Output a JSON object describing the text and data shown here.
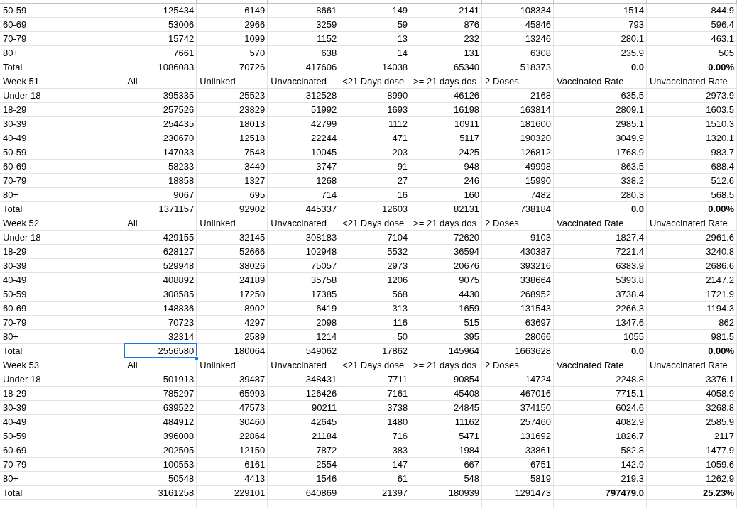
{
  "sheet": {
    "rows": [
      {
        "kind": "data",
        "selection": [
          false,
          false,
          false,
          false,
          false,
          false,
          false,
          false,
          false
        ],
        "cells": [
          "50-59",
          "125434",
          "6149",
          "8661",
          "149",
          "2141",
          "108334",
          "1514",
          "844.9"
        ]
      },
      {
        "kind": "data",
        "selection": [
          false,
          false,
          false,
          false,
          false,
          false,
          false,
          false,
          false
        ],
        "cells": [
          "60-69",
          "53006",
          "2966",
          "3259",
          "59",
          "876",
          "45846",
          "793",
          "596.4"
        ]
      },
      {
        "kind": "data",
        "selection": [
          false,
          false,
          false,
          false,
          false,
          false,
          false,
          false,
          false
        ],
        "cells": [
          "70-79",
          "15742",
          "1099",
          "1152",
          "13",
          "232",
          "13246",
          "280.1",
          "463.1"
        ]
      },
      {
        "kind": "data",
        "selection": [
          false,
          false,
          false,
          false,
          false,
          false,
          false,
          false,
          false
        ],
        "cells": [
          "80+",
          "7661",
          "570",
          "638",
          "14",
          "131",
          "6308",
          "235.9",
          "505"
        ]
      },
      {
        "kind": "total",
        "selection": [
          false,
          false,
          false,
          false,
          false,
          false,
          false,
          false,
          false
        ],
        "cells": [
          "Total",
          "1086083",
          "70726",
          "417606",
          "14038",
          "65340",
          "518373",
          "0.0",
          "0.00%"
        ]
      },
      {
        "kind": "header",
        "selection": [
          false,
          false,
          false,
          false,
          false,
          false,
          false,
          false,
          false
        ],
        "cells": [
          "Week 51",
          "All",
          "Unlinked",
          "Unvaccinated",
          "<21 Days dose",
          ">= 21 days dos",
          "2 Doses",
          "Vaccinated Rate",
          "Unvaccinated Rate"
        ]
      },
      {
        "kind": "data",
        "selection": [
          false,
          false,
          false,
          false,
          false,
          false,
          false,
          false,
          false
        ],
        "cells": [
          "Under 18",
          "395335",
          "25523",
          "312528",
          "8990",
          "46126",
          "2168",
          "635.5",
          "2973.9"
        ]
      },
      {
        "kind": "data",
        "selection": [
          false,
          false,
          false,
          false,
          false,
          false,
          false,
          false,
          false
        ],
        "cells": [
          "18-29",
          "257526",
          "23829",
          "51992",
          "1693",
          "16198",
          "163814",
          "2809.1",
          "1603.5"
        ]
      },
      {
        "kind": "data",
        "selection": [
          false,
          false,
          false,
          false,
          false,
          false,
          false,
          false,
          false
        ],
        "cells": [
          "30-39",
          "254435",
          "18013",
          "42799",
          "1112",
          "10911",
          "181600",
          "2985.1",
          "1510.3"
        ]
      },
      {
        "kind": "data",
        "selection": [
          false,
          false,
          false,
          false,
          false,
          false,
          false,
          false,
          false
        ],
        "cells": [
          "40-49",
          "230670",
          "12518",
          "22244",
          "471",
          "5117",
          "190320",
          "3049.9",
          "1320.1"
        ]
      },
      {
        "kind": "data",
        "selection": [
          false,
          false,
          false,
          false,
          false,
          false,
          false,
          false,
          false
        ],
        "cells": [
          "50-59",
          "147033",
          "7548",
          "10045",
          "203",
          "2425",
          "126812",
          "1768.9",
          "983.7"
        ]
      },
      {
        "kind": "data",
        "selection": [
          false,
          false,
          false,
          false,
          false,
          false,
          false,
          false,
          false
        ],
        "cells": [
          "60-69",
          "58233",
          "3449",
          "3747",
          "91",
          "948",
          "49998",
          "863.5",
          "688.4"
        ]
      },
      {
        "kind": "data",
        "selection": [
          false,
          false,
          false,
          false,
          false,
          false,
          false,
          false,
          false
        ],
        "cells": [
          "70-79",
          "18858",
          "1327",
          "1268",
          "27",
          "246",
          "15990",
          "338.2",
          "512.6"
        ]
      },
      {
        "kind": "data",
        "selection": [
          false,
          false,
          false,
          false,
          false,
          false,
          false,
          false,
          false
        ],
        "cells": [
          "80+",
          "9067",
          "695",
          "714",
          "16",
          "160",
          "7482",
          "280.3",
          "568.5"
        ]
      },
      {
        "kind": "total",
        "selection": [
          false,
          false,
          false,
          false,
          false,
          false,
          false,
          false,
          false
        ],
        "cells": [
          "Total",
          "1371157",
          "92902",
          "445337",
          "12603",
          "82131",
          "738184",
          "0.0",
          "0.00%"
        ]
      },
      {
        "kind": "header",
        "selection": [
          false,
          false,
          false,
          false,
          false,
          false,
          false,
          false,
          false
        ],
        "cells": [
          "Week 52",
          "All",
          "Unlinked",
          "Unvaccinated",
          "<21 Days dose",
          ">= 21 days dos",
          "2 Doses",
          "Vaccinated Rate",
          "Unvaccinated Rate"
        ]
      },
      {
        "kind": "data",
        "selection": [
          false,
          false,
          false,
          false,
          false,
          false,
          false,
          false,
          false
        ],
        "cells": [
          "Under 18",
          "429155",
          "32145",
          "308183",
          "7104",
          "72620",
          "9103",
          "1827.4",
          "2961.6"
        ]
      },
      {
        "kind": "data",
        "selection": [
          false,
          false,
          false,
          false,
          false,
          false,
          false,
          false,
          false
        ],
        "cells": [
          "18-29",
          "628127",
          "52666",
          "102948",
          "5532",
          "36594",
          "430387",
          "7221.4",
          "3240.8"
        ]
      },
      {
        "kind": "data",
        "selection": [
          false,
          false,
          false,
          false,
          false,
          false,
          false,
          false,
          false
        ],
        "cells": [
          "30-39",
          "529948",
          "38026",
          "75057",
          "2973",
          "20676",
          "393216",
          "6383.9",
          "2686.6"
        ]
      },
      {
        "kind": "data",
        "selection": [
          false,
          false,
          false,
          false,
          false,
          false,
          false,
          false,
          false
        ],
        "cells": [
          "40-49",
          "408892",
          "24189",
          "35758",
          "1206",
          "9075",
          "338664",
          "5393.8",
          "2147.2"
        ]
      },
      {
        "kind": "data",
        "selection": [
          false,
          false,
          false,
          false,
          false,
          false,
          false,
          false,
          false
        ],
        "cells": [
          "50-59",
          "308585",
          "17250",
          "17385",
          "568",
          "4430",
          "268952",
          "3738.4",
          "1721.9"
        ]
      },
      {
        "kind": "data",
        "selection": [
          false,
          false,
          false,
          false,
          false,
          false,
          false,
          false,
          false
        ],
        "cells": [
          "60-69",
          "148836",
          "8902",
          "6419",
          "313",
          "1659",
          "131543",
          "2266.3",
          "1194.3"
        ]
      },
      {
        "kind": "data",
        "selection": [
          false,
          false,
          false,
          false,
          false,
          false,
          false,
          false,
          false
        ],
        "cells": [
          "70-79",
          "70723",
          "4297",
          "2098",
          "116",
          "515",
          "63697",
          "1347.6",
          "862"
        ]
      },
      {
        "kind": "data",
        "selection": [
          false,
          false,
          false,
          false,
          false,
          false,
          false,
          false,
          false
        ],
        "cells": [
          "80+",
          "32314",
          "2589",
          "1214",
          "50",
          "395",
          "28066",
          "1055",
          "981.5"
        ]
      },
      {
        "kind": "total",
        "selection": [
          false,
          true,
          false,
          false,
          false,
          false,
          false,
          false,
          false
        ],
        "cells": [
          "Total",
          "2556580",
          "180064",
          "549062",
          "17862",
          "145964",
          "1663628",
          "0.0",
          "0.00%"
        ]
      },
      {
        "kind": "header",
        "selection": [
          false,
          false,
          false,
          false,
          false,
          false,
          false,
          false,
          false
        ],
        "cells": [
          "Week 53",
          "All",
          "Unlinked",
          "Unvaccinated",
          "<21 Days dose",
          ">= 21 days dos",
          "2 Doses",
          "Vaccinated Rate",
          "Unvaccinated Rate"
        ]
      },
      {
        "kind": "data",
        "selection": [
          false,
          false,
          false,
          false,
          false,
          false,
          false,
          false,
          false
        ],
        "cells": [
          "Under 18",
          "501913",
          "39487",
          "348431",
          "7711",
          "90854",
          "14724",
          "2248.8",
          "3376.1"
        ]
      },
      {
        "kind": "data",
        "selection": [
          false,
          false,
          false,
          false,
          false,
          false,
          false,
          false,
          false
        ],
        "cells": [
          "18-29",
          "785297",
          "65993",
          "126426",
          "7161",
          "45408",
          "467016",
          "7715.1",
          "4058.9"
        ]
      },
      {
        "kind": "data",
        "selection": [
          false,
          false,
          false,
          false,
          false,
          false,
          false,
          false,
          false
        ],
        "cells": [
          "30-39",
          "639522",
          "47573",
          "90211",
          "3738",
          "24845",
          "374150",
          "6024.6",
          "3268.8"
        ]
      },
      {
        "kind": "data",
        "selection": [
          false,
          false,
          false,
          false,
          false,
          false,
          false,
          false,
          false
        ],
        "cells": [
          "40-49",
          "484912",
          "30460",
          "42645",
          "1480",
          "11162",
          "257460",
          "4082.9",
          "2585.9"
        ]
      },
      {
        "kind": "data",
        "selection": [
          false,
          false,
          false,
          false,
          false,
          false,
          false,
          false,
          false
        ],
        "cells": [
          "50-59",
          "396008",
          "22864",
          "21184",
          "716",
          "5471",
          "131692",
          "1826.7",
          "2117"
        ]
      },
      {
        "kind": "data",
        "selection": [
          false,
          false,
          false,
          false,
          false,
          false,
          false,
          false,
          false
        ],
        "cells": [
          "60-69",
          "202505",
          "12150",
          "7872",
          "383",
          "1984",
          "33861",
          "582.8",
          "1477.9"
        ]
      },
      {
        "kind": "data",
        "selection": [
          false,
          false,
          false,
          false,
          false,
          false,
          false,
          false,
          false
        ],
        "cells": [
          "70-79",
          "100553",
          "6161",
          "2554",
          "147",
          "667",
          "6751",
          "142.9",
          "1059.6"
        ]
      },
      {
        "kind": "data",
        "selection": [
          false,
          false,
          false,
          false,
          false,
          false,
          false,
          false,
          false
        ],
        "cells": [
          "80+",
          "50548",
          "4413",
          "1546",
          "61",
          "548",
          "5819",
          "219.3",
          "1262.9"
        ]
      },
      {
        "kind": "total",
        "selection": [
          false,
          false,
          false,
          false,
          false,
          false,
          false,
          false,
          false
        ],
        "cells": [
          "Total",
          "3161258",
          "229101",
          "640869",
          "21397",
          "180939",
          "1291473",
          "797479.0",
          "25.23%"
        ]
      }
    ]
  }
}
